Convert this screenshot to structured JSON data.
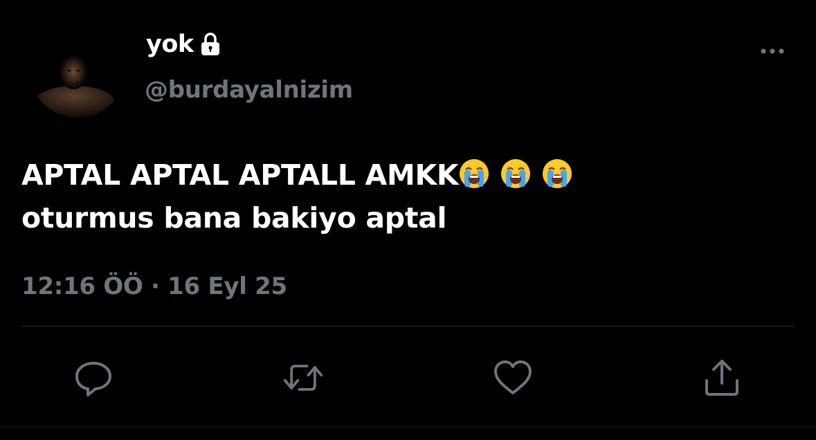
{
  "tweet": {
    "display_name": "yok",
    "handle": "@burdayalnizim",
    "text_line1": "APTAL APTAL APTALL AMKK",
    "text_line2": "oturmus bana bakiyo aptal",
    "emojis": [
      "loudly-crying-face",
      "loudly-crying-face",
      "loudly-crying-face"
    ],
    "timestamp": "12:16 ÖÖ · 16 Eyl 25",
    "protected_account": true
  },
  "actions": [
    "reply-icon",
    "retweet-icon",
    "like-icon",
    "share-icon"
  ],
  "colors": {
    "background": "#000000",
    "text": "#ffffff",
    "secondary_text": "#6e767d",
    "divider": "#2f3336"
  }
}
